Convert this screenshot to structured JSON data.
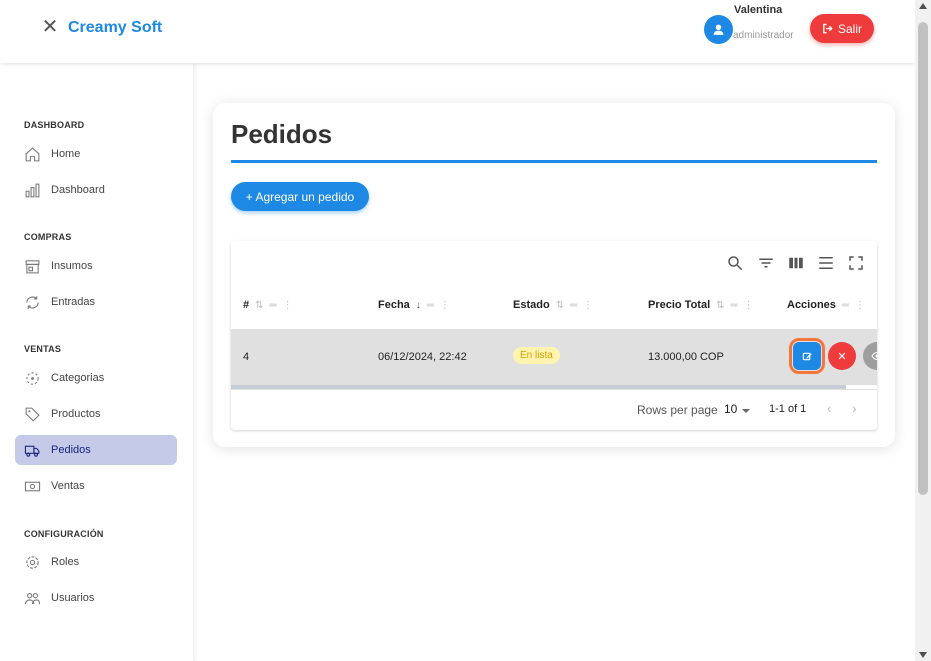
{
  "header": {
    "brand": "Creamy Soft",
    "user_name": "Valentina",
    "user_role": "administrador",
    "logout_label": "Salir"
  },
  "sidebar": {
    "sections": [
      {
        "title": "DASHBOARD",
        "items": [
          {
            "label": "Home",
            "icon": "home-icon"
          },
          {
            "label": "Dashboard",
            "icon": "bar-chart-icon"
          }
        ]
      },
      {
        "title": "COMPRAS",
        "items": [
          {
            "label": "Insumos",
            "icon": "store-icon"
          },
          {
            "label": "Entradas",
            "icon": "sync-icon"
          }
        ]
      },
      {
        "title": "VENTAS",
        "items": [
          {
            "label": "Categorias",
            "icon": "category-icon"
          },
          {
            "label": "Productos",
            "icon": "tag-icon"
          },
          {
            "label": "Pedidos",
            "icon": "truck-icon",
            "active": true
          },
          {
            "label": "Ventas",
            "icon": "money-icon"
          }
        ]
      },
      {
        "title": "CONFIGURACIÓN",
        "items": [
          {
            "label": "Roles",
            "icon": "gear-icon"
          },
          {
            "label": "Usuarios",
            "icon": "users-icon"
          }
        ]
      }
    ]
  },
  "main": {
    "title": "Pedidos",
    "add_button": "+ Agregar un pedido",
    "table": {
      "columns": [
        "#",
        "Fecha",
        "Estado",
        "Precio Total",
        "Acciones"
      ],
      "rows": [
        {
          "id": "4",
          "fecha": "06/12/2024, 22:42",
          "estado": "En lista",
          "precio": "13.000,00 COP"
        }
      ],
      "footer": {
        "rows_per_page_label": "Rows per page",
        "rows_per_page_value": "10",
        "range": "1-1 of 1"
      }
    }
  },
  "colors": {
    "primary": "#1e88e5",
    "danger": "#ef3b3b",
    "active_nav_bg": "#c5cae9",
    "status_chip_bg": "#fff3b0",
    "status_chip_text": "#d4a000",
    "highlight_outline": "#f4763b"
  }
}
